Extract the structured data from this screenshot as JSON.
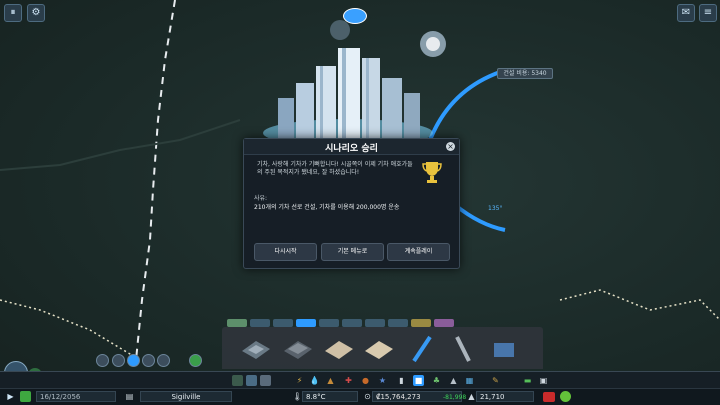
{
  "overlay": {
    "distance_label": "건설 비용: 5340",
    "angle_label": "135°"
  },
  "dialog": {
    "title": "시나리오 승리",
    "message": "기차, 사랑해 기차가 기뻐합니다! 시골쪽이 이제 기차 애호가들의 주된 목적지가 됐네요, 잘 하셨습니다!",
    "reason_label": "사유:",
    "reason_text": "210개의 기차 선로 건설, 기차를 이용해 200,000명 운송",
    "buttons": {
      "restart": "다시시작",
      "main_menu": "기본 메뉴로",
      "continue": "계속플레이"
    }
  },
  "status": {
    "date": "16/12/2056",
    "city_name": "Sigilville",
    "temperature": "8.8°C",
    "money": "₡15,764,273",
    "income": "-81,998",
    "population": "21,710",
    "level": "5"
  },
  "colors": {
    "accent": "#2e9bff",
    "money_income_positive": "#3ed65a",
    "background": "#1d2e2c"
  },
  "icons": {
    "top_left": [
      "pause-icon",
      "unlock-icon"
    ],
    "top_right": "chirper-icon",
    "trophy": "trophy-icon"
  }
}
